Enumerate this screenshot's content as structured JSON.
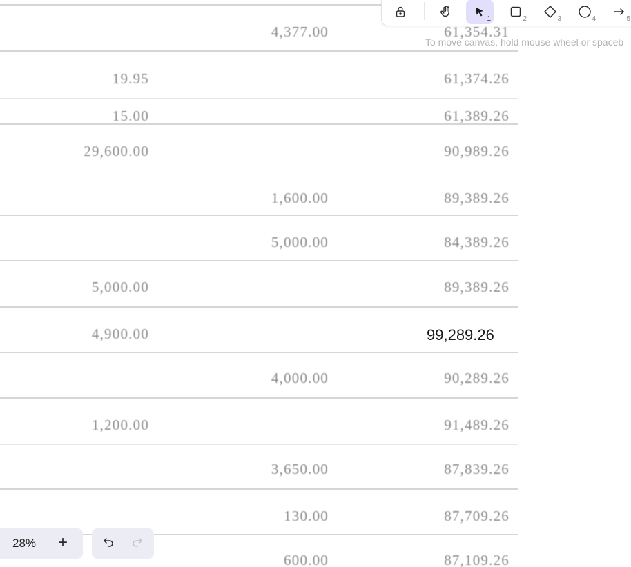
{
  "ledger": {
    "rows": [
      {
        "debit": "",
        "credit": "4,377.00",
        "balance": "61,354.31"
      },
      {
        "debit": "19.95",
        "credit": "",
        "balance": "61,374.26"
      },
      {
        "debit": "15.00",
        "credit": "",
        "balance": "61,389.26"
      },
      {
        "debit": "29,600.00",
        "credit": "",
        "balance": "90,989.26"
      },
      {
        "debit": "",
        "credit": "1,600.00",
        "balance": "89,389.26"
      },
      {
        "debit": "",
        "credit": "5,000.00",
        "balance": "84,389.26"
      },
      {
        "debit": "5,000.00",
        "credit": "",
        "balance": "89,389.26"
      },
      {
        "debit": "4,900.00",
        "credit": "",
        "balance": "99,289.26"
      },
      {
        "debit": "",
        "credit": "4,000.00",
        "balance": "90,289.26"
      },
      {
        "debit": "1,200.00",
        "credit": "",
        "balance": "91,489.26"
      },
      {
        "debit": "",
        "credit": "3,650.00",
        "balance": "87,839.26"
      },
      {
        "debit": "",
        "credit": "130.00",
        "balance": "87,709.26"
      },
      {
        "debit": "",
        "credit": "600.00",
        "balance": "87,109.26"
      }
    ]
  },
  "toolbar": {
    "tools": [
      {
        "name": "lock",
        "key": ""
      },
      {
        "name": "hand",
        "key": ""
      },
      {
        "name": "selection",
        "key": "1"
      },
      {
        "name": "rectangle",
        "key": "2"
      },
      {
        "name": "diamond",
        "key": "3"
      },
      {
        "name": "ellipse",
        "key": "4"
      },
      {
        "name": "arrow",
        "key": "5"
      }
    ],
    "active_tool": "selection",
    "hint": "To move canvas, hold mouse wheel or spaceb"
  },
  "footer": {
    "zoom": "28%",
    "zoom_in": "+"
  },
  "colors": {
    "active_tool_bg": "#e2dffd",
    "control_bg": "#ececf4"
  }
}
